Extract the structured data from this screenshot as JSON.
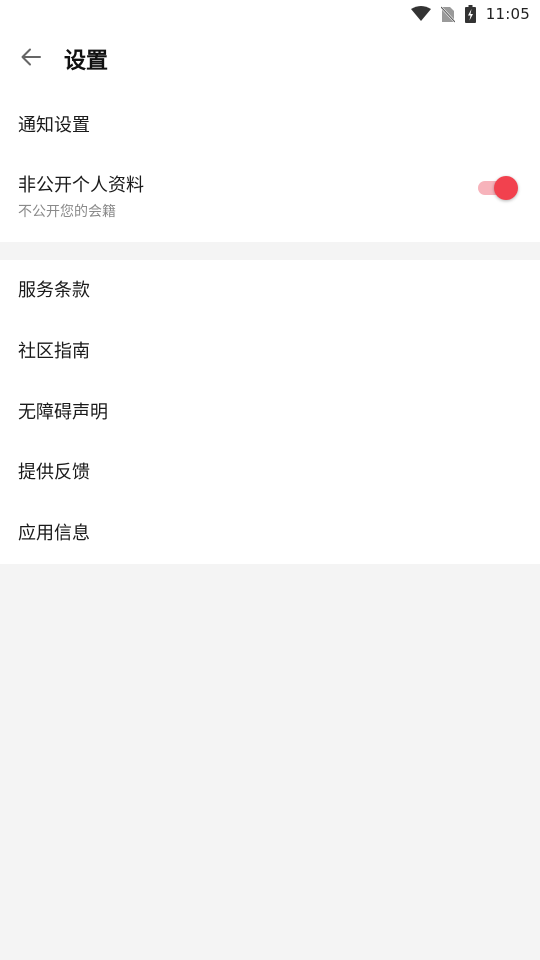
{
  "status_bar": {
    "time": "11:05",
    "icons": [
      "wifi-icon",
      "no-sim-icon",
      "battery-charging-icon"
    ]
  },
  "header": {
    "title": "设置",
    "back_icon": "arrow-left-icon"
  },
  "sections": [
    {
      "items": [
        {
          "label": "通知设置"
        },
        {
          "label": "非公开个人资料",
          "sublabel": "不公开您的会籍",
          "toggle": true
        }
      ]
    },
    {
      "items": [
        {
          "label": "服务条款"
        },
        {
          "label": "社区指南"
        },
        {
          "label": "无障碍声明"
        },
        {
          "label": "提供反馈"
        },
        {
          "label": "应用信息"
        }
      ]
    }
  ],
  "colors": {
    "accent": "#f2414e",
    "accent_track": "#f7b3bb",
    "background": "#f4f4f4",
    "surface": "#ffffff"
  }
}
